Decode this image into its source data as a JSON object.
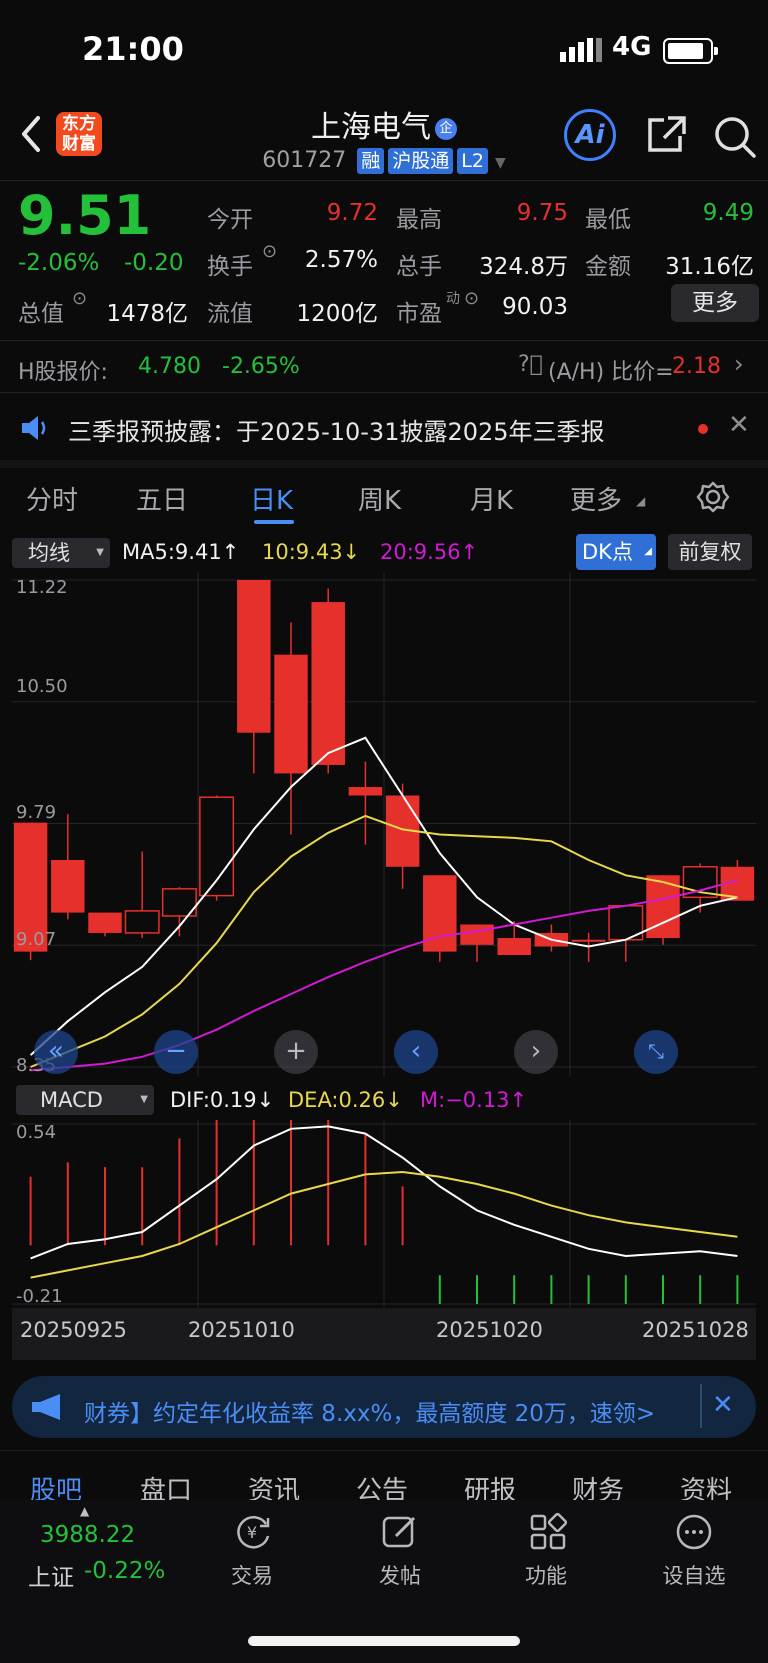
{
  "status": {
    "time": "21:00",
    "network": "4G"
  },
  "header": {
    "logo_line1": "东方",
    "logo_line2": "财富",
    "stock_name": "上海电气",
    "stock_badge": "企",
    "stock_code": "601727",
    "tags": [
      "融",
      "沪股通",
      "L2"
    ],
    "ai_label": "Ai"
  },
  "quote": {
    "price": "9.51",
    "change_pct": "-2.06%",
    "change_abs": "-0.20",
    "open_label": "今开",
    "open": "9.72",
    "high_label": "最高",
    "high": "9.75",
    "low_label": "最低",
    "low": "9.49",
    "turnover_label": "换手",
    "turnover": "2.57%",
    "volume_label": "总手",
    "volume": "324.8万",
    "amount_label": "金额",
    "amount": "31.16亿",
    "mcap_label": "总值",
    "mcap": "1478亿",
    "float_label": "流值",
    "float": "1200亿",
    "pe_label": "市盈",
    "pe_sup": "动",
    "pe": "90.03",
    "more_label": "更多"
  },
  "hshare": {
    "label": "H股报价:",
    "price": "4.780",
    "change": "-2.65%",
    "ratio_label": "(A/H) 比价=",
    "ratio": "2.18"
  },
  "notice": {
    "text": "三季报预披露：于2025-10-31披露2025年三季报"
  },
  "period_tabs": [
    "分时",
    "五日",
    "日K",
    "周K",
    "月K",
    "更多"
  ],
  "active_tab": "日K",
  "ma_bar": {
    "selector": "均线",
    "ma5": "MA5:9.41↑",
    "ma10": "10:9.43↓",
    "ma20": "20:9.56↑",
    "dk_label": "DK点",
    "fq_label": "前复权"
  },
  "kline_axis": {
    "ticks": [
      "11.22",
      "10.50",
      "9.79",
      "9.07",
      "8.35"
    ]
  },
  "macd_bar": {
    "selector": "MACD",
    "dif": "DIF:0.19↓",
    "dea": "DEA:0.26↓",
    "m": "M:−0.13↑"
  },
  "macd_axis": {
    "ticks": [
      "0.54",
      "-0.21"
    ]
  },
  "chart_data": {
    "type": "candlestick",
    "dates": [
      "20250925",
      "20251010",
      "20251020",
      "20251028"
    ],
    "candles": [
      {
        "o": 9.79,
        "h": 9.79,
        "l": 8.98,
        "c": 9.03
      },
      {
        "o": 9.57,
        "h": 9.84,
        "l": 9.22,
        "c": 9.26
      },
      {
        "o": 9.26,
        "h": 9.26,
        "l": 9.12,
        "c": 9.14
      },
      {
        "o": 9.14,
        "h": 9.62,
        "l": 9.11,
        "c": 9.27
      },
      {
        "o": 9.24,
        "h": 9.41,
        "l": 9.12,
        "c": 9.4
      },
      {
        "o": 9.36,
        "h": 9.95,
        "l": 9.33,
        "c": 9.94
      },
      {
        "o": 11.22,
        "h": 11.22,
        "l": 10.08,
        "c": 10.32
      },
      {
        "o": 10.78,
        "h": 10.97,
        "l": 9.72,
        "c": 10.08
      },
      {
        "o": 11.09,
        "h": 11.17,
        "l": 10.08,
        "c": 10.13
      },
      {
        "o": 10.0,
        "h": 10.15,
        "l": 9.66,
        "c": 9.95
      },
      {
        "o": 9.95,
        "h": 10.02,
        "l": 9.4,
        "c": 9.53
      },
      {
        "o": 9.48,
        "h": 9.48,
        "l": 8.97,
        "c": 9.03
      },
      {
        "o": 9.19,
        "h": 9.19,
        "l": 8.97,
        "c": 9.07
      },
      {
        "o": 9.11,
        "h": 9.21,
        "l": 9.03,
        "c": 9.01
      },
      {
        "o": 9.14,
        "h": 9.19,
        "l": 9.03,
        "c": 9.06
      },
      {
        "o": 9.1,
        "h": 9.14,
        "l": 8.97,
        "c": 9.09
      },
      {
        "o": 9.1,
        "h": 9.1,
        "l": 8.97,
        "c": 9.3
      },
      {
        "o": 9.48,
        "h": 9.48,
        "l": 9.07,
        "c": 9.11
      },
      {
        "o": 9.35,
        "h": 9.55,
        "l": 9.26,
        "c": 9.53
      },
      {
        "o": 9.53,
        "h": 9.57,
        "l": 9.33,
        "c": 9.33
      }
    ],
    "ma5": [
      8.42,
      8.62,
      8.79,
      8.94,
      9.18,
      9.45,
      9.75,
      10.0,
      10.2,
      10.29,
      9.95,
      9.61,
      9.35,
      9.19,
      9.1,
      9.06,
      9.1,
      9.2,
      9.3,
      9.35
    ],
    "ma10": [
      8.35,
      8.44,
      8.53,
      8.66,
      8.84,
      9.08,
      9.38,
      9.59,
      9.73,
      9.83,
      9.75,
      9.72,
      9.71,
      9.7,
      9.68,
      9.57,
      9.48,
      9.44,
      9.38,
      9.35
    ],
    "ma20": [
      8.33,
      8.35,
      8.37,
      8.41,
      8.48,
      8.57,
      8.68,
      8.78,
      8.88,
      8.97,
      9.05,
      9.12,
      9.15,
      9.19,
      9.23,
      9.27,
      9.3,
      9.34,
      9.39,
      9.45
    ],
    "macd_dif": [
      -0.02,
      0.04,
      0.06,
      0.09,
      0.2,
      0.31,
      0.45,
      0.52,
      0.53,
      0.5,
      0.4,
      0.28,
      0.18,
      0.12,
      0.07,
      0.02,
      -0.01,
      0.0,
      0.01,
      -0.01
    ],
    "macd_dea": [
      -0.1,
      -0.07,
      -0.04,
      -0.01,
      0.04,
      0.11,
      0.18,
      0.25,
      0.29,
      0.33,
      0.34,
      0.32,
      0.29,
      0.25,
      0.2,
      0.16,
      0.13,
      0.11,
      0.09,
      0.07
    ],
    "macd_m": [
      0.16,
      0.22,
      0.2,
      0.2,
      0.32,
      0.4,
      0.54,
      0.54,
      0.48,
      0.34,
      0.12,
      -0.01,
      -0.21,
      -0.21,
      -0.21,
      -0.21,
      -0.21,
      -0.21,
      -0.21,
      -0.21
    ],
    "ylim_price": [
      8.35,
      11.22
    ],
    "ylim_macd": [
      -0.21,
      0.54
    ]
  },
  "ad_banner": {
    "text": "财券】约定年化收益率 8.xx%，最高额度 20万，速领>"
  },
  "section_tabs": [
    "股吧",
    "盘口",
    "资讯",
    "公告",
    "研报",
    "财务",
    "资料"
  ],
  "index": {
    "value": "3988.22",
    "name": "上证",
    "change": "-0.22%"
  },
  "bottom_nav": [
    "交易",
    "发帖",
    "功能",
    "设自选"
  ],
  "colors": {
    "up": "#e6302c",
    "down": "#25c03a",
    "accent": "#4a8df5",
    "ma5": "#ffffff",
    "ma10": "#e8d84a",
    "ma20": "#d11ad1"
  }
}
